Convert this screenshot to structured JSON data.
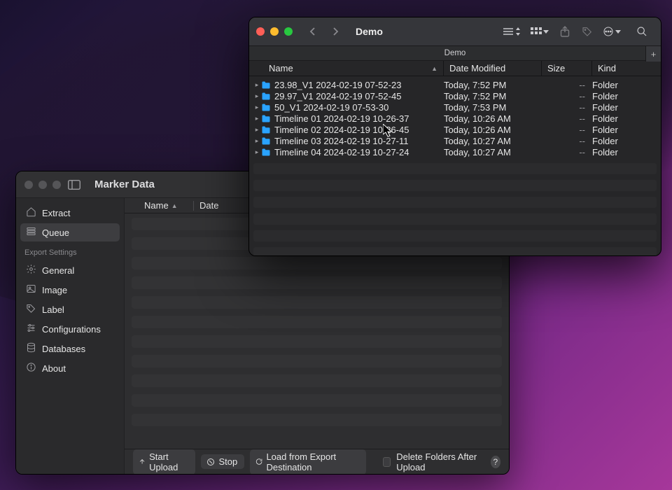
{
  "marker_data": {
    "title": "Marker Data",
    "sidebar": {
      "items": [
        {
          "label": "Extract",
          "icon": "extract-icon"
        },
        {
          "label": "Queue",
          "icon": "queue-icon",
          "selected": true
        }
      ],
      "section_label": "Export Settings",
      "settings": [
        {
          "label": "General",
          "icon": "gear-icon"
        },
        {
          "label": "Image",
          "icon": "image-icon"
        },
        {
          "label": "Label",
          "icon": "tag-icon"
        },
        {
          "label": "Configurations",
          "icon": "sliders-icon"
        },
        {
          "label": "Databases",
          "icon": "database-icon"
        },
        {
          "label": "About",
          "icon": "info-icon"
        }
      ]
    },
    "columns": {
      "name": "Name",
      "date": "Date"
    },
    "footer": {
      "start_upload": "Start Upload",
      "stop": "Stop",
      "load_from": "Load from Export Destination",
      "delete_after": "Delete Folders After Upload",
      "help": "?"
    }
  },
  "finder": {
    "title": "Demo",
    "tab": "Demo",
    "columns": {
      "name": "Name",
      "date": "Date Modified",
      "size": "Size",
      "kind": "Kind"
    },
    "rows": [
      {
        "name": "23.98_V1 2024-02-19 07-52-23",
        "date": "Today, 7:52 PM",
        "size": "--",
        "kind": "Folder"
      },
      {
        "name": "29.97_V1 2024-02-19 07-52-45",
        "date": "Today, 7:52 PM",
        "size": "--",
        "kind": "Folder"
      },
      {
        "name": "50_V1 2024-02-19 07-53-30",
        "date": "Today, 7:53 PM",
        "size": "--",
        "kind": "Folder"
      },
      {
        "name": "Timeline 01 2024-02-19 10-26-37",
        "date": "Today, 10:26 AM",
        "size": "--",
        "kind": "Folder"
      },
      {
        "name": "Timeline 02 2024-02-19 10-26-45",
        "date": "Today, 10:26 AM",
        "size": "--",
        "kind": "Folder"
      },
      {
        "name": "Timeline 03 2024-02-19 10-27-11",
        "date": "Today, 10:27 AM",
        "size": "--",
        "kind": "Folder"
      },
      {
        "name": "Timeline 04 2024-02-19 10-27-24",
        "date": "Today, 10:27 AM",
        "size": "--",
        "kind": "Folder"
      }
    ]
  }
}
